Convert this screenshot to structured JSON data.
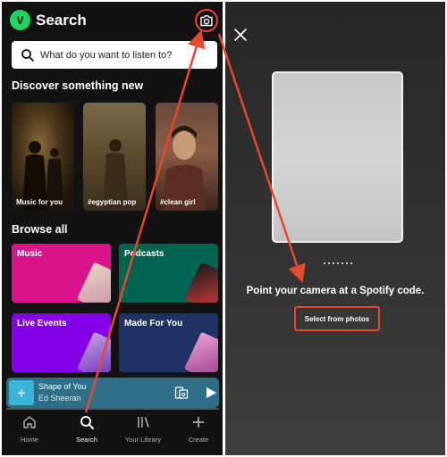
{
  "header": {
    "avatar_letter": "V",
    "title": "Search"
  },
  "search": {
    "placeholder": "What do you want to listen to?"
  },
  "discover": {
    "heading": "Discover something new",
    "cards": [
      {
        "label": "Music for you"
      },
      {
        "label": "#egyptian pop"
      },
      {
        "label": "#clean girl"
      }
    ]
  },
  "browse": {
    "heading": "Browse all",
    "tiles": [
      {
        "label": "Music",
        "color": "#dc148c"
      },
      {
        "label": "Podcasts",
        "color": "#006450"
      },
      {
        "label": "Live Events",
        "color": "#8400e7"
      },
      {
        "label": "Made For You",
        "color": "#1e3264"
      }
    ]
  },
  "now_playing": {
    "title": "Shape of You",
    "artist": "Ed Sheeran",
    "art_symbol": "÷",
    "progress": 0.0
  },
  "nav": [
    {
      "label": "Home",
      "icon": "home-icon"
    },
    {
      "label": "Search",
      "icon": "search-icon",
      "active": true
    },
    {
      "label": "Your Library",
      "icon": "library-icon"
    },
    {
      "label": "Create",
      "icon": "plus-icon"
    }
  ],
  "scanner": {
    "instruction": "Point your camera at a Spotify code.",
    "select_label": "Select from photos"
  },
  "colors": {
    "accent": "#1ed760",
    "annotation": "#e8472e"
  }
}
